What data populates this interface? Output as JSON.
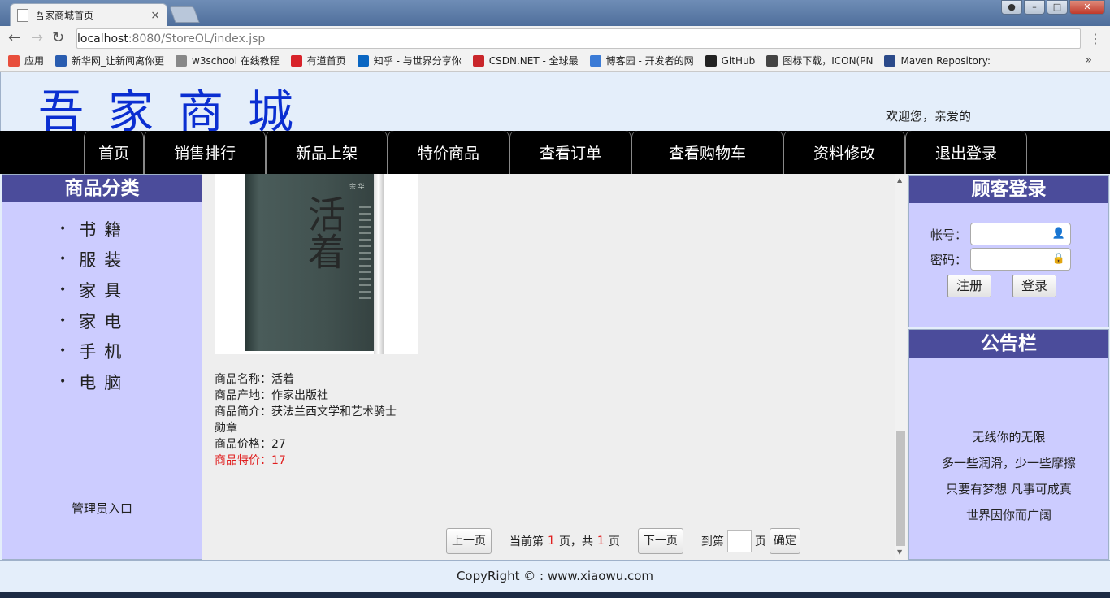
{
  "browser": {
    "tab_title": "吾家商城首页",
    "tab_close": "×",
    "url_host": "localhost",
    "url_rest": ":8080/StoreOL/index.jsp",
    "info_icon": "i",
    "back": "←",
    "forward": "→",
    "reload": "↻",
    "zoom_icon": "⊕",
    "star_icon": "☆",
    "menu": "⋮",
    "bookmarks": [
      {
        "icon": "apps-icon",
        "label": "应用",
        "color": "#e84e3c"
      },
      {
        "icon": "xinhua-icon",
        "label": "新华网_让新闻离你更",
        "color": "#2a5db0"
      },
      {
        "icon": "page-icon",
        "label": "w3school 在线教程",
        "color": "#888888"
      },
      {
        "icon": "youdao-icon",
        "label": "有道首页",
        "color": "#d8232a"
      },
      {
        "icon": "zhihu-icon",
        "label": "知乎 - 与世界分享你",
        "color": "#0a66c2"
      },
      {
        "icon": "csdn-icon",
        "label": "CSDN.NET - 全球最",
        "color": "#c9262b"
      },
      {
        "icon": "cnblogs-icon",
        "label": "博客园 - 开发者的网",
        "color": "#3b7bd6"
      },
      {
        "icon": "github-icon",
        "label": "GitHub",
        "color": "#222222"
      },
      {
        "icon": "iconfont-icon",
        "label": "图标下载，ICON(PN",
        "color": "#444444"
      },
      {
        "icon": "maven-icon",
        "label": "Maven Repository:",
        "color": "#2b4a8a"
      }
    ],
    "more": "»"
  },
  "header": {
    "logo": "吾家商城",
    "welcome": "欢迎您，亲爱的"
  },
  "nav": [
    "首页",
    "销售排行",
    "新品上架",
    "特价商品",
    "查看订单",
    "查看购物车",
    "资料修改",
    "退出登录"
  ],
  "categories": {
    "title": "商品分类",
    "items": [
      "书籍",
      "服装",
      "家具",
      "家电",
      "手机",
      "电脑"
    ],
    "admin": "管理员入口"
  },
  "product": {
    "cover_title": "活着",
    "name": "商品名称：活着",
    "origin": "商品产地：作家出版社",
    "desc_line1": "商品简介：获法兰西文学和艺术骑士",
    "desc_line2": "勋章",
    "price": "商品价格：27",
    "special": "商品特价：17"
  },
  "pager": {
    "prev": "上一页",
    "current_prefix": "当前第",
    "current": "1",
    "mid": "页，共",
    "total": "1",
    "suffix": "页",
    "next": "下一页",
    "goto_prefix": "到第",
    "goto_suffix": "页",
    "confirm": "确定"
  },
  "login": {
    "title": "顾客登录",
    "account_label": "帐号：",
    "password_label": "密码：",
    "register": "注册",
    "login": "登录"
  },
  "notice": {
    "title": "公告栏",
    "lines": [
      "无线你的无限",
      "多一些润滑，少一些摩擦",
      "只要有梦想 凡事可成真",
      "世界因你而广阔"
    ]
  },
  "footer": {
    "copyright": "CopyRight © : www.xiaowu.com"
  },
  "colors": {
    "logo": "#0a2ed1",
    "panel_header": "#4b4c9b",
    "panel_bg": "#ccccff",
    "nav_bg": "#000000",
    "special_price": "#e01e1e"
  }
}
